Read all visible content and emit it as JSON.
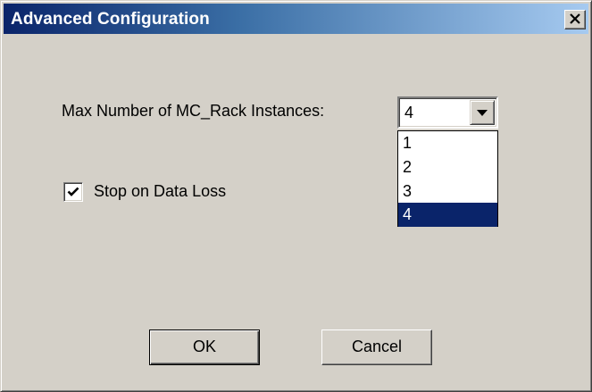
{
  "window": {
    "title": "Advanced Configuration",
    "close_icon": "close-icon"
  },
  "form": {
    "max_instances_label": "Max Number of MC_Rack Instances:",
    "max_instances_value": "4",
    "max_instances_options": [
      "1",
      "2",
      "3",
      "4"
    ],
    "selected_option_index": 3,
    "stop_on_data_loss_label": "Stop on Data Loss",
    "stop_on_data_loss_checked": true
  },
  "buttons": {
    "ok_label": "OK",
    "cancel_label": "Cancel"
  },
  "colors": {
    "dialog_bg": "#d4d0c8",
    "titlebar_start": "#0a246a",
    "titlebar_end": "#a6caf0",
    "selection": "#0a246a"
  }
}
